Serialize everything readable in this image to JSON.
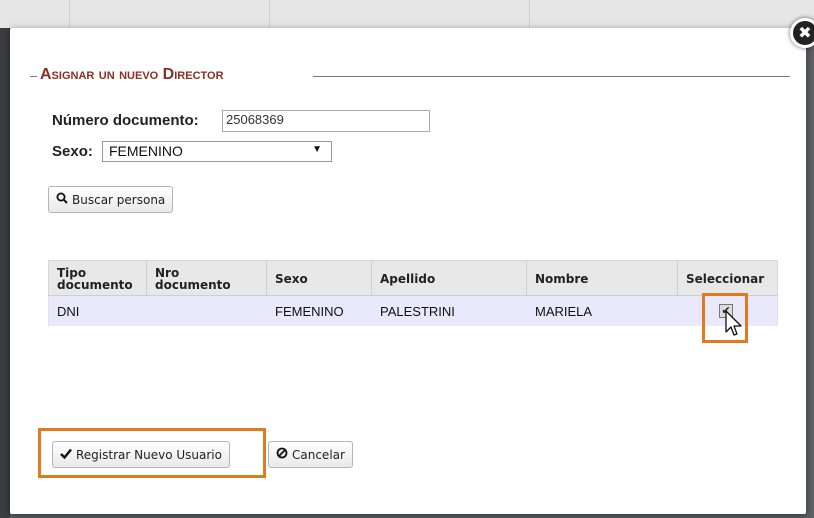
{
  "modal": {
    "section_title": "Asignar un nuevo Director",
    "close_symbol": "✖"
  },
  "form": {
    "documento_label": "Número documento:",
    "documento_value": "25068369",
    "sexo_label": "Sexo:",
    "sexo_value": "FEMENINO"
  },
  "buttons": {
    "buscar_label": "Buscar persona",
    "registrar_label": "Registrar Nuevo Usuario",
    "cancelar_label": "Cancelar"
  },
  "table": {
    "headers": [
      {
        "l1": "Tipo",
        "l2": "documento"
      },
      {
        "l1": "Nro",
        "l2": "documento"
      },
      {
        "l1": "Sexo",
        "l2": ""
      },
      {
        "l1": "Apellido",
        "l2": ""
      },
      {
        "l1": "Nombre",
        "l2": ""
      },
      {
        "l1": "Seleccionar",
        "l2": ""
      }
    ],
    "rows": [
      {
        "tipo": "DNI",
        "nro": "",
        "sexo": "FEMENINO",
        "apellido": "PALESTRINI",
        "nombre": "MARIELA",
        "selected": true
      }
    ]
  },
  "colors": {
    "title": "#8b2f24",
    "highlight": "#e07a1f",
    "row_bg": "#e9e9fb"
  },
  "icons": [
    "close-icon",
    "search-icon",
    "check-icon",
    "cancel-icon",
    "checkbox-checked-icon",
    "cursor-pointer-icon"
  ]
}
